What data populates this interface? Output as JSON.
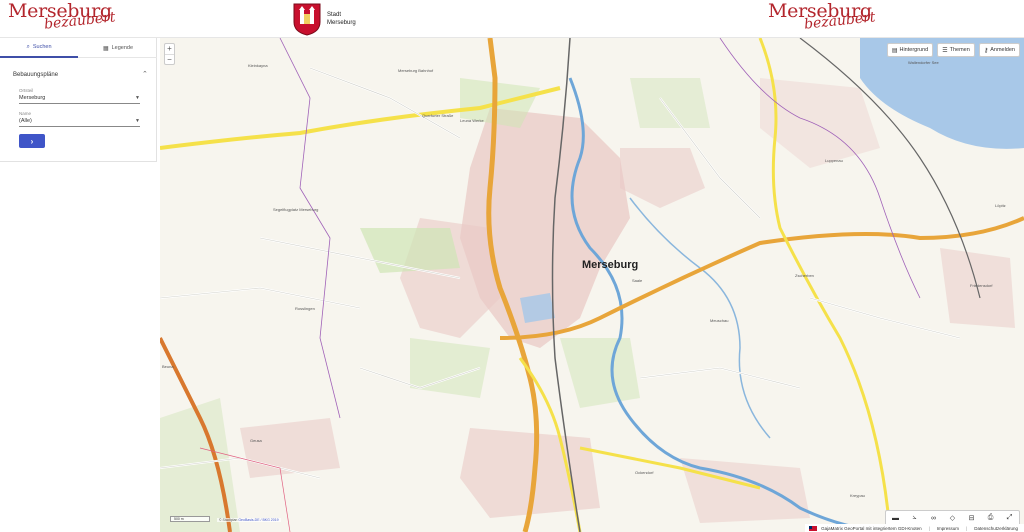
{
  "header": {
    "brand_word": "Merseburg",
    "brand_script": "bezaubert",
    "stadt_line1": "Stadt",
    "stadt_line2": "Merseburg"
  },
  "sidebar": {
    "tabs": [
      {
        "label": "Suchen",
        "icon": "search-icon",
        "active": true
      },
      {
        "label": "Legende",
        "icon": "legend-icon",
        "active": false
      }
    ],
    "section_title": "Bebauungspläne",
    "fields": [
      {
        "label": "Ortsteil",
        "value": "Merseburg"
      },
      {
        "label": "Name",
        "value": "(Alle)"
      }
    ],
    "go_button_icon": "chevron-right-icon"
  },
  "map": {
    "zoom_in": "+",
    "zoom_out": "−",
    "top_buttons": [
      {
        "label": "Hintergrund",
        "icon": "map-icon"
      },
      {
        "label": "Themen",
        "icon": "layers-icon"
      },
      {
        "label": "Anmelden",
        "icon": "key-icon"
      }
    ],
    "city_label": "Merseburg",
    "labels": [
      "Kleinkayna",
      "Merseburg Bahnhof",
      "Leuna Werke",
      "Segelflugplatz Merseburg",
      "Beuna",
      "Geusa",
      "Ockendorf",
      "Wallendorfer See",
      "Friedensdorf",
      "Kreypau",
      "Löpitz",
      "Zscherben",
      "Querfurter Straße",
      "Saale",
      "Luppenau",
      "Meuschau",
      "Rosslingen"
    ],
    "attribution_text": "© Stadtplan ",
    "attribution_link": "GeoBasis-DE / BKG 2019",
    "scale_text": "500 m",
    "tools": [
      {
        "label": "▬",
        "icon": "measure-line-icon"
      },
      {
        "label": "⦣",
        "icon": "measure-angle-icon"
      },
      {
        "label": "∞",
        "icon": "route-icon"
      },
      {
        "label": "◇",
        "icon": "polygon-icon"
      },
      {
        "label": "⊟",
        "icon": "compare-icon"
      },
      {
        "label": "⎙",
        "icon": "print-icon"
      },
      {
        "label": "⤢",
        "icon": "fullscreen-icon"
      }
    ]
  },
  "footer": {
    "portal": "GajaMatrix GeoPortal mit integriertem GDI-Knoten",
    "imprint": "Impressum",
    "privacy": "Datenschutzerklärung"
  },
  "colors": {
    "brand_red": "#b3262d",
    "accent_blue": "#3f55c8",
    "water": "#a8c8e8",
    "road_orange": "#e8a53a",
    "road_yellow": "#f5e14a",
    "urban": "#e9c9c6",
    "green": "#cfe5b5"
  }
}
